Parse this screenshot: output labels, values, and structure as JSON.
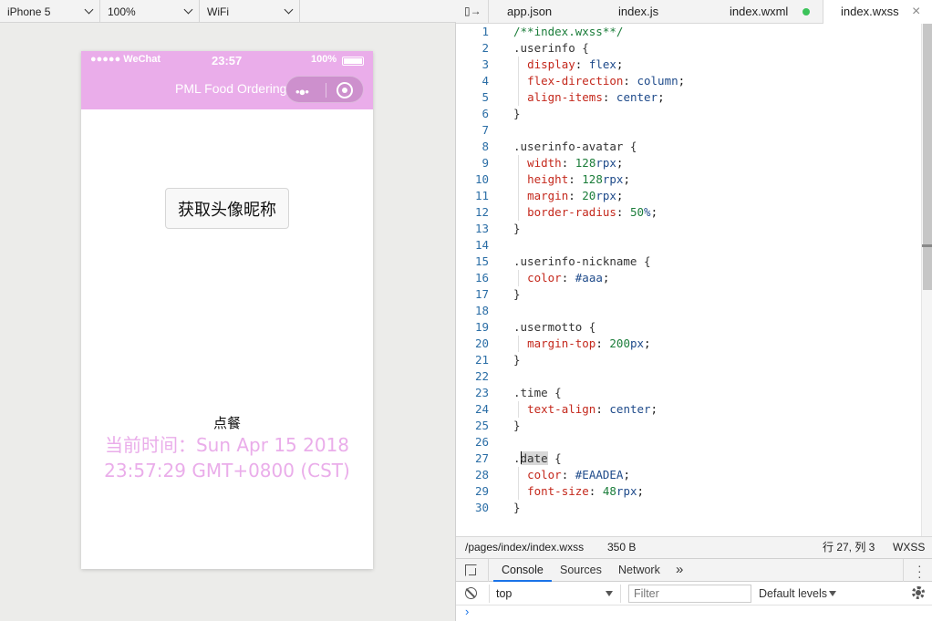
{
  "simulator": {
    "device": "iPhone 5",
    "zoom": "100%",
    "network": "WiFi",
    "status": {
      "signal": "●●●●● WeChat",
      "time": "23:57",
      "battery": "100%"
    },
    "nav_title": "PML Food Ordering",
    "capsule_dots": "•●•",
    "button_label": "获取头像昵称",
    "order_text": "点餐",
    "time_text": "当前时间：Sun Apr 15 2018 23:57:29 GMT+0800 (CST)",
    "accent": "#EAADEA"
  },
  "editor": {
    "tabs": [
      {
        "label": "app.json"
      },
      {
        "label": "index.js"
      },
      {
        "label": "index.wxml",
        "modified": true
      },
      {
        "label": "index.wxss",
        "active": true
      }
    ],
    "lines": [
      {
        "n": "1",
        "t": "/**index.wxss**/"
      },
      {
        "n": "2",
        "t": ".userinfo {"
      },
      {
        "n": "3",
        "p": "display",
        "v": "flex"
      },
      {
        "n": "4",
        "p": "flex-direction",
        "v": "column"
      },
      {
        "n": "5",
        "p": "align-items",
        "v": "center"
      },
      {
        "n": "6",
        "t": "}"
      },
      {
        "n": "7",
        "t": ""
      },
      {
        "n": "8",
        "t": ".userinfo-avatar {"
      },
      {
        "n": "9",
        "p": "width",
        "num": "128",
        "u": "rpx"
      },
      {
        "n": "10",
        "p": "height",
        "num": "128",
        "u": "rpx"
      },
      {
        "n": "11",
        "p": "margin",
        "num": "20",
        "u": "rpx"
      },
      {
        "n": "12",
        "p": "border-radius",
        "num": "50",
        "u": "%"
      },
      {
        "n": "13",
        "t": "}"
      },
      {
        "n": "14",
        "t": ""
      },
      {
        "n": "15",
        "t": ".userinfo-nickname {"
      },
      {
        "n": "16",
        "p": "color",
        "v": "#aaa"
      },
      {
        "n": "17",
        "t": "}"
      },
      {
        "n": "18",
        "t": ""
      },
      {
        "n": "19",
        "t": ".usermotto {"
      },
      {
        "n": "20",
        "p": "margin-top",
        "num": "200",
        "u": "px"
      },
      {
        "n": "21",
        "t": "}"
      },
      {
        "n": "22",
        "t": ""
      },
      {
        "n": "23",
        "t": ".time {"
      },
      {
        "n": "24",
        "p": "text-align",
        "v": "center"
      },
      {
        "n": "25",
        "t": "}"
      },
      {
        "n": "26",
        "t": ""
      },
      {
        "n": "27",
        "t": ".date {"
      },
      {
        "n": "28",
        "p": "color",
        "v": "#EAADEA"
      },
      {
        "n": "29",
        "p": "font-size",
        "num": "48",
        "u": "rpx"
      },
      {
        "n": "30",
        "t": "}"
      }
    ],
    "status": {
      "path": "/pages/index/index.wxss",
      "size": "350 B",
      "position": "行 27, 列 3",
      "language": "WXSS"
    }
  },
  "devtools": {
    "tabs": [
      "Console",
      "Sources",
      "Network"
    ],
    "more": "»",
    "context": "top",
    "filter_placeholder": "Filter",
    "levels": "Default levels",
    "prompt": "›"
  }
}
